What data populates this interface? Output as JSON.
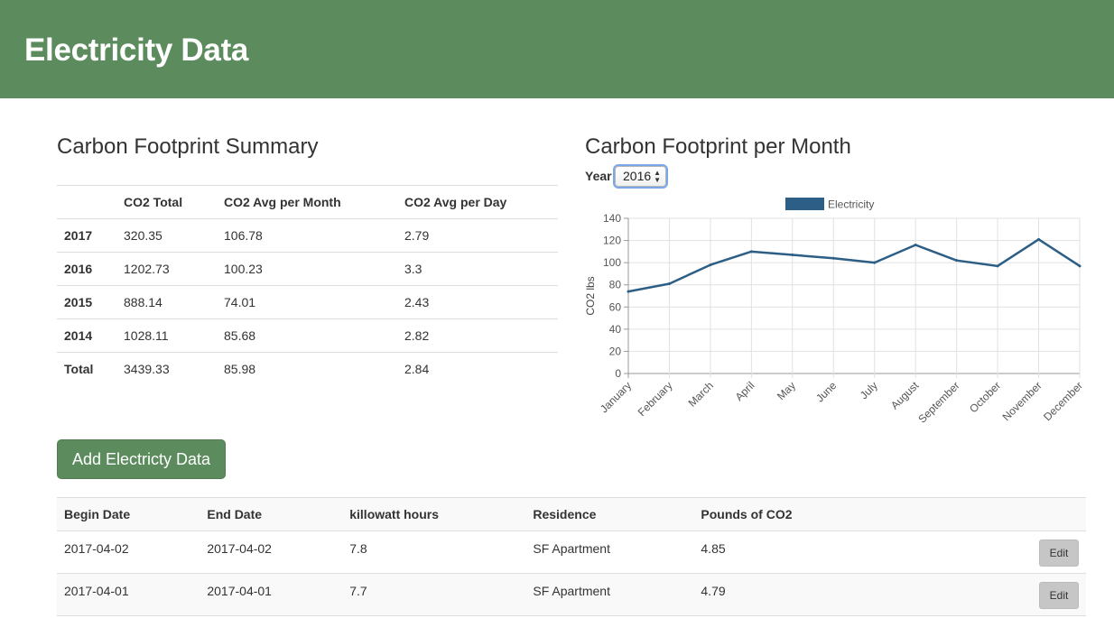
{
  "header": {
    "title": "Electricity Data"
  },
  "summary": {
    "title": "Carbon Footprint Summary",
    "columns": [
      "",
      "CO2 Total",
      "CO2 Avg per Month",
      "CO2 Avg per Day"
    ],
    "rows": [
      [
        "2017",
        "320.35",
        "106.78",
        "2.79"
      ],
      [
        "2016",
        "1202.73",
        "100.23",
        "3.3"
      ],
      [
        "2015",
        "888.14",
        "74.01",
        "2.43"
      ],
      [
        "2014",
        "1028.11",
        "85.68",
        "2.82"
      ],
      [
        "Total",
        "3439.33",
        "85.98",
        "2.84"
      ]
    ]
  },
  "monthly": {
    "title": "Carbon Footprint per Month",
    "year_label": "Year",
    "year_value": "2016"
  },
  "chart_data": {
    "type": "line",
    "categories": [
      "January",
      "February",
      "March",
      "April",
      "May",
      "June",
      "July",
      "August",
      "September",
      "October",
      "November",
      "December"
    ],
    "series": [
      {
        "name": "Electricity",
        "values": [
          74,
          81,
          98,
          110,
          107,
          104,
          100,
          116,
          102,
          97,
          121,
          97
        ]
      }
    ],
    "ylabel": "CO2 lbs",
    "ylim": [
      0,
      140
    ],
    "yticks": [
      0,
      20,
      40,
      60,
      80,
      100,
      120,
      140
    ],
    "grid": true,
    "legend": "top",
    "color": "#2d5f86"
  },
  "actions": {
    "add_label": "Add Electricty Data"
  },
  "entries": {
    "columns": [
      "Begin Date",
      "End Date",
      "killowatt hours",
      "Residence",
      "Pounds of CO2",
      ""
    ],
    "rows": [
      {
        "begin": "2017-04-02",
        "end": "2017-04-02",
        "kwh": "7.8",
        "residence": "SF Apartment",
        "co2": "4.85",
        "edit": "Edit"
      },
      {
        "begin": "2017-04-01",
        "end": "2017-04-01",
        "kwh": "7.7",
        "residence": "SF Apartment",
        "co2": "4.79",
        "edit": "Edit"
      }
    ]
  }
}
